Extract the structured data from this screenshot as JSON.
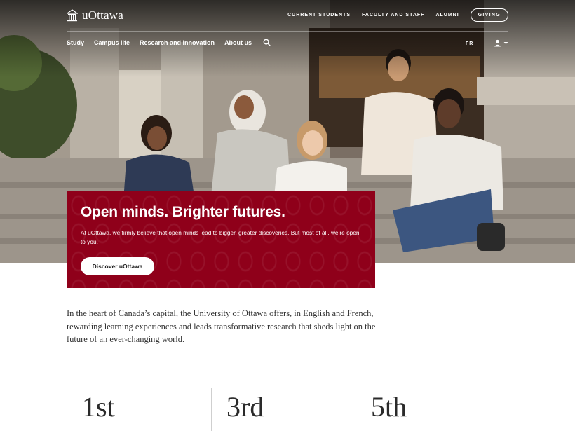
{
  "brand": {
    "name": "uOttawa"
  },
  "header": {
    "utility_links": [
      "CURRENT STUDENTS",
      "FACULTY AND STAFF",
      "ALUMNI"
    ],
    "giving_label": "GIVING",
    "main_nav": [
      "Study",
      "Campus life",
      "Research and innovation",
      "About us"
    ],
    "lang_label": "FR"
  },
  "hero": {
    "headline": "Open minds. Brighter futures.",
    "body": "At uOttawa, we firmly believe that open minds lead to bigger, greater discoveries. But most of all, we’re open to you.",
    "cta_label": "Discover uOttawa"
  },
  "intro": {
    "text": "In the heart of Canada’s capital, the University of Ottawa offers, in English and French, rewarding learning experiences and leads transformative research that sheds light on the future of an ever-changing world."
  },
  "stats": [
    "1st",
    "3rd",
    "5th"
  ],
  "colors": {
    "brand_red": "#8f001a",
    "header_text": "#ffffff"
  },
  "icons": {
    "logo": "university-building-icon",
    "search": "search-icon",
    "account": "user-icon",
    "dropdown": "caret-down-icon"
  }
}
